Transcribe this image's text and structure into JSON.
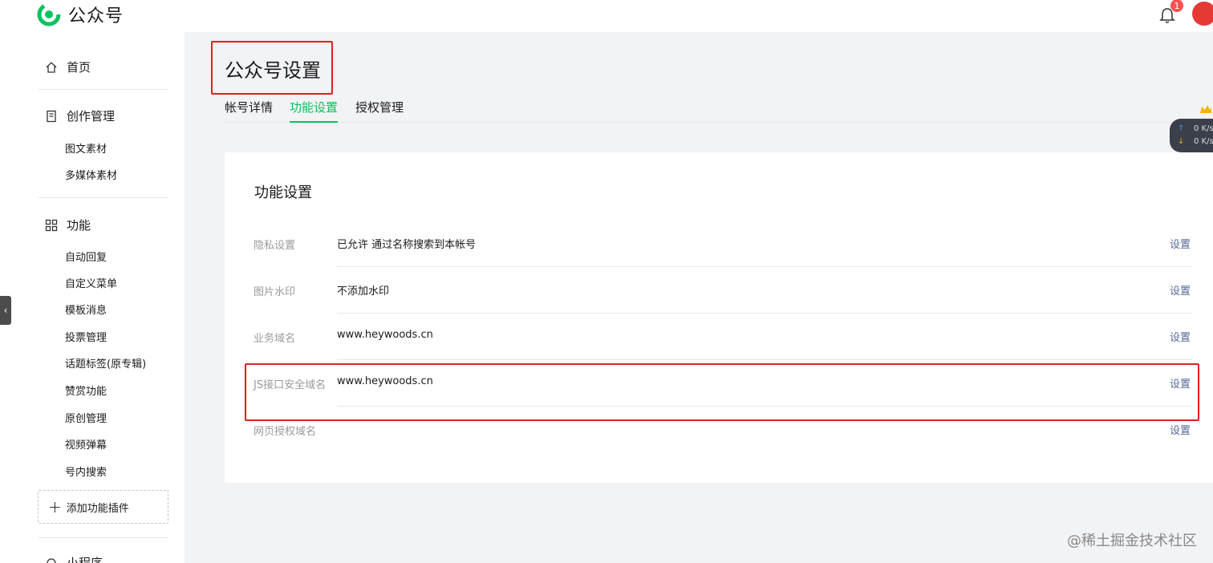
{
  "header": {
    "app_name": "公众号",
    "notification_count": "1",
    "brand_color": "#07c160"
  },
  "sidebar": {
    "home": "首页",
    "creation": {
      "title": "创作管理",
      "items": [
        "图文素材",
        "多媒体素材"
      ]
    },
    "features": {
      "title": "功能",
      "items": [
        "自动回复",
        "自定义菜单",
        "模板消息",
        "投票管理",
        "话题标签(原专辑)",
        "赞赏功能",
        "原创管理",
        "视频弹幕",
        "号内搜索"
      ]
    },
    "add_plugin": "添加功能插件",
    "mini_program": "小程序"
  },
  "main": {
    "page_title": "公众号设置",
    "tabs": [
      {
        "label": "帐号详情",
        "active": false
      },
      {
        "label": "功能设置",
        "active": true
      },
      {
        "label": "授权管理",
        "active": false
      }
    ],
    "card_title": "功能设置",
    "rows": [
      {
        "label": "隐私设置",
        "value": "已允许 通过名称搜索到本帐号",
        "action": "设置"
      },
      {
        "label": "图片水印",
        "value": "不添加水印",
        "action": "设置"
      },
      {
        "label": "业务域名",
        "value": "www.heywoods.cn",
        "action": "设置"
      },
      {
        "label": "JS接口安全域名",
        "value": "www.heywoods.cn",
        "action": "设置"
      },
      {
        "label": "网页授权域名",
        "value": "",
        "action": "设置"
      }
    ]
  },
  "speed_widget": {
    "up": "0 K/s",
    "down": "0 K/s"
  },
  "watermark": "@稀土掘金技术社区"
}
